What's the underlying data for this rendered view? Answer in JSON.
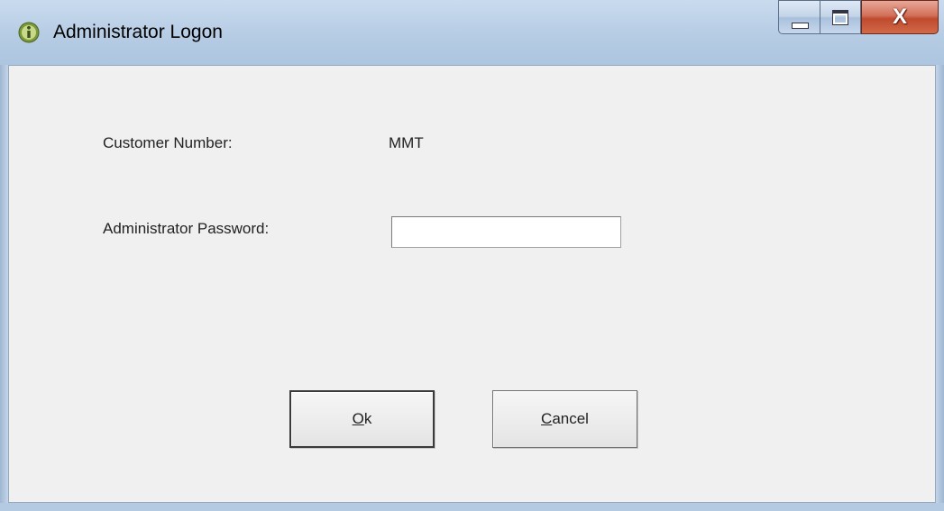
{
  "window": {
    "title": "Administrator Logon",
    "icon": "info-icon",
    "caption_buttons": {
      "minimize_icon": "minimize-icon",
      "maximize_icon": "maximize-icon",
      "close_glyph": "X"
    }
  },
  "form": {
    "customer_number_label": "Customer Number:",
    "customer_number_value": "MMT",
    "password_label": "Administrator Password:",
    "password_value": "",
    "password_placeholder": ""
  },
  "buttons": {
    "ok_mnemonic": "O",
    "ok_rest": "k",
    "cancel_mnemonic": "C",
    "cancel_rest": "ancel"
  },
  "colors": {
    "titlebar": "#b6cce4",
    "close_button": "#c04a2f",
    "client_background": "#f0f0f0",
    "app_icon": "#7a9a3a"
  }
}
